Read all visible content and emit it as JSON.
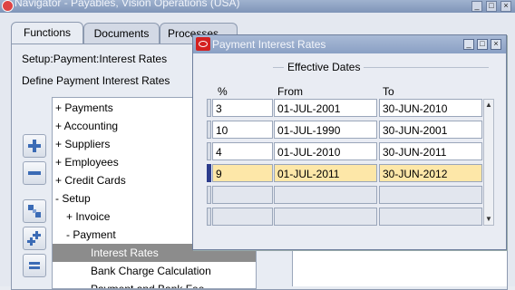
{
  "navigator": {
    "title": "Navigator - Payables, Vision Operations (USA)",
    "tabs": [
      {
        "label": "Functions"
      },
      {
        "label": "Documents"
      },
      {
        "label": "Processes"
      }
    ],
    "setup_path": "Setup:Payment:Interest Rates",
    "define_label": "Define Payment Interest Rates",
    "tree": [
      {
        "label": "+  Payments"
      },
      {
        "label": "+  Accounting"
      },
      {
        "label": "+  Suppliers"
      },
      {
        "label": "+  Employees"
      },
      {
        "label": "+  Credit Cards"
      },
      {
        "label": "-  Setup"
      },
      {
        "label": "+  Invoice"
      },
      {
        "label": "-  Payment"
      },
      {
        "label": "Interest Rates"
      },
      {
        "label": "Bank Charge Calculation"
      },
      {
        "label": "Payment and Bank Fee..."
      }
    ]
  },
  "dialog": {
    "title": "Payment Interest Rates",
    "group_label": "Effective Dates",
    "columns": {
      "pct": "%",
      "from": "From",
      "to": "To"
    },
    "rows": [
      {
        "pct": "3",
        "from": "01-JUL-2001",
        "to": "30-JUN-2010"
      },
      {
        "pct": "10",
        "from": "01-JUL-1990",
        "to": "30-JUN-2001"
      },
      {
        "pct": "4",
        "from": "01-JUL-2010",
        "to": "30-JUN-2011"
      },
      {
        "pct": "9",
        "from": "01-JUL-2011",
        "to": "30-JUN-2012"
      },
      {
        "pct": "",
        "from": "",
        "to": ""
      },
      {
        "pct": "",
        "from": "",
        "to": ""
      }
    ]
  },
  "colors": {
    "highlight_row": "#fde7a8",
    "selected_tree": "#8c8c8c",
    "titlebar": "#8aa0c4"
  }
}
